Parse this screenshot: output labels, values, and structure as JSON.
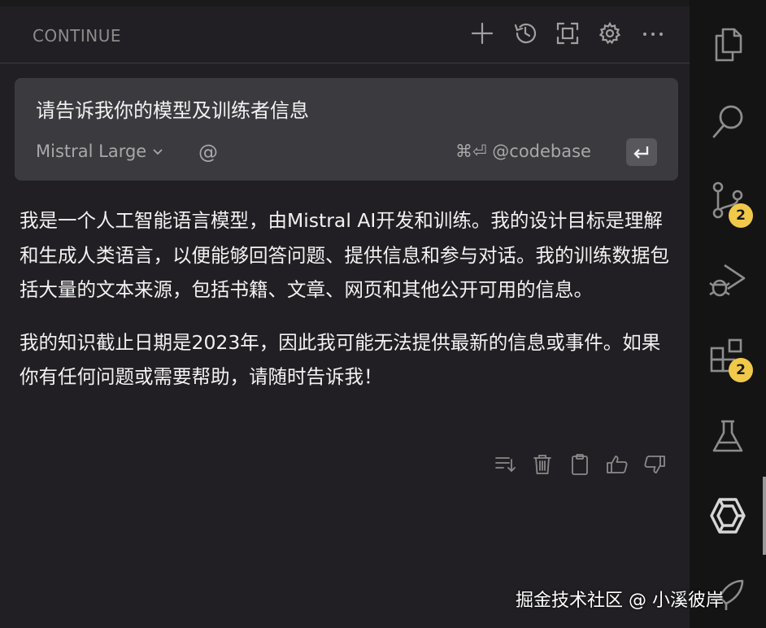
{
  "header": {
    "title": "CONTINUE",
    "icons": [
      "plus-icon",
      "history-icon",
      "fullscreen-icon",
      "gear-icon",
      "more-icon"
    ]
  },
  "input": {
    "query": "请告诉我你的模型及训练者信息",
    "model": "Mistral Large",
    "at_symbol": "@",
    "codebase_hint": "⌘⏎ @codebase"
  },
  "response": {
    "paragraphs": [
      "我是一个人工智能语言模型，由Mistral AI开发和训练。我的设计目标是理解和生成人类语言，以便能够回答问题、提供信息和参与对话。我的训练数据包括大量的文本来源，包括书籍、文章、网页和其他公开可用的信息。",
      "我的知识截止日期是2023年，因此我可能无法提供最新的信息或事件。如果你有任何问题或需要帮助，请随时告诉我！"
    ]
  },
  "message_actions": [
    "insert-icon",
    "trash-icon",
    "clipboard-icon",
    "thumbs-up-icon",
    "thumbs-down-icon"
  ],
  "activity_bar": {
    "items": [
      {
        "name": "explorer-icon",
        "badge": ""
      },
      {
        "name": "search-icon",
        "badge": ""
      },
      {
        "name": "source-control-icon",
        "badge": "2"
      },
      {
        "name": "run-debug-icon",
        "badge": ""
      },
      {
        "name": "extensions-icon",
        "badge": "2"
      },
      {
        "name": "testing-icon",
        "badge": ""
      },
      {
        "name": "continue-icon",
        "badge": ""
      },
      {
        "name": "rocket-icon",
        "badge": ""
      }
    ]
  },
  "watermark": "掘金技术社区 @ 小溪彼岸",
  "colors": {
    "panel_bg": "#211f23",
    "input_bg": "#3b3a3f",
    "activity_bg": "#141415",
    "badge": "#f0c94a",
    "text": "#f2f2f2",
    "muted": "#a8a8a8"
  }
}
